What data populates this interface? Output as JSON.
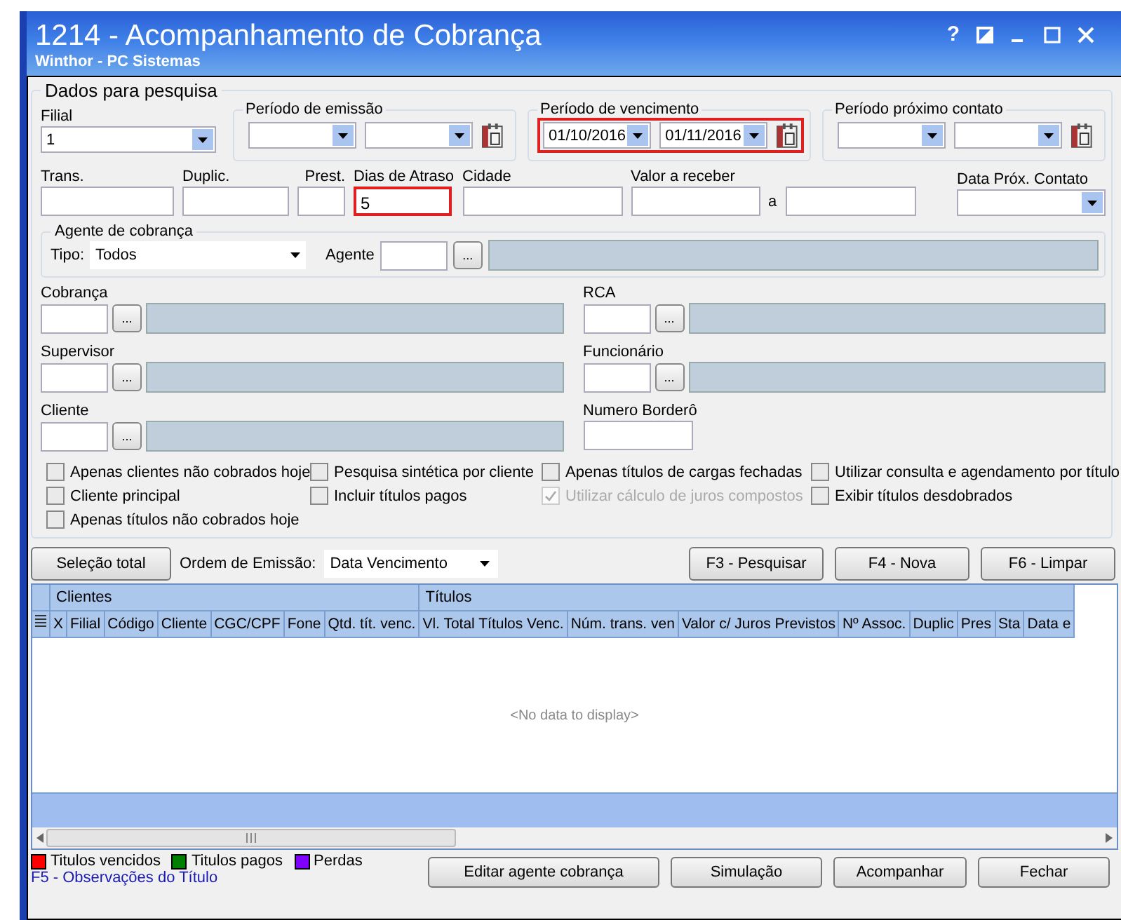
{
  "window": {
    "title": "1214 - Acompanhamento de Cobrança",
    "subtitle": "Winthor - PC Sistemas",
    "help": "?"
  },
  "search": {
    "title": "Dados para pesquisa",
    "filial": {
      "label": "Filial",
      "value": "1"
    },
    "periods": [
      {
        "title": "Período de emissão",
        "highlighted": false
      },
      {
        "title": "Período de vencimento",
        "start": "01/10/2016",
        "end": "01/11/2016",
        "highlighted": true
      },
      {
        "title": "Período próximo contato",
        "highlighted": false
      }
    ],
    "fields": [
      {
        "kind": "text",
        "label": "Trans.",
        "highlighted": false
      },
      {
        "kind": "text",
        "label": "Duplic.",
        "highlighted": false
      },
      {
        "kind": "text",
        "label": "Prest.",
        "highlighted": false
      },
      {
        "kind": "text",
        "label": "Dias de Atraso",
        "value": "5",
        "highlighted": true
      },
      {
        "kind": "text",
        "label": "Cidade",
        "highlighted": false
      },
      {
        "kind": "text",
        "label": "Valor a receber",
        "highlighted": false
      },
      {
        "kind": "connector",
        "label": "a"
      },
      {
        "kind": "text",
        "highlighted": false
      },
      {
        "kind": "combo",
        "label": "Data Próx. Contato",
        "highlighted": false
      }
    ],
    "agent": {
      "title": "Agente de cobrança",
      "type_label": "Tipo:",
      "type_value": "Todos",
      "agent_label": "Agente",
      "button": "..."
    },
    "lookups": [
      {
        "kind": "lookup",
        "label": "Cobrança",
        "button": "..."
      },
      {
        "kind": "lookup",
        "label": "RCA",
        "button": "..."
      },
      {
        "kind": "lookup",
        "label": "Supervisor",
        "button": "..."
      },
      {
        "kind": "lookup",
        "label": "Funcionário",
        "button": "..."
      },
      {
        "kind": "lookup",
        "label": "Cliente",
        "button": "..."
      },
      {
        "kind": "plain",
        "label": "Numero Borderô"
      }
    ],
    "options": [
      {
        "label": "Apenas clientes não cobrados hoje",
        "checked": false,
        "disabled": false
      },
      {
        "label": "Pesquisa sintética por cliente",
        "checked": false,
        "disabled": false
      },
      {
        "label": "Apenas títulos de cargas fechadas",
        "checked": false,
        "disabled": false
      },
      {
        "label": "Utilizar consulta e agendamento por título",
        "checked": false,
        "disabled": false
      },
      {
        "label": "Cliente principal",
        "checked": false,
        "disabled": false
      },
      {
        "label": "Incluir títulos pagos",
        "checked": false,
        "disabled": false
      },
      {
        "label": "Utilizar cálculo de juros compostos",
        "checked": true,
        "disabled": true
      },
      {
        "label": "Exibir títulos desdobrados",
        "checked": false,
        "disabled": false
      },
      {
        "label": "Apenas títulos não cobrados hoje",
        "checked": false,
        "disabled": false
      }
    ]
  },
  "toolbar": {
    "select_all": "Seleção total",
    "order_label": "Ordem de Emissão:",
    "order_value": "Data Vencimento",
    "buttons": [
      "F3 - Pesquisar",
      "F4 - Nova",
      "F6 - Limpar"
    ]
  },
  "grid": {
    "bands": [
      "Clientes",
      "Títulos"
    ],
    "columns": [
      "X",
      "Filial",
      "Código",
      "Cliente",
      "CGC/CPF",
      "Fone",
      "Qtd. tít. venc.",
      "Vl. Total Títulos Venc.",
      "Núm. trans. ven",
      "Valor c/ Juros Previstos",
      "Nº Assoc.",
      "Duplic",
      "Pres",
      "Sta",
      "Data e"
    ],
    "empty_text": "<No data to display>"
  },
  "legend": [
    {
      "label": "Titulos vencidos",
      "color": "#ff0000"
    },
    {
      "label": "Titulos pagos",
      "color": "#008000"
    },
    {
      "label": "Perdas",
      "color": "#8000ff"
    }
  ],
  "hint": "F5 - Observações do Título",
  "buttons": [
    "Editar agente cobrança",
    "Simulação",
    "Acompanhar",
    "Fechar"
  ]
}
